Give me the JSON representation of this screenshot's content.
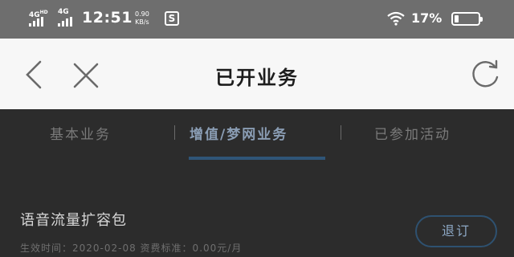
{
  "status_bar": {
    "network_1": "4G",
    "network_1_sup": "HD",
    "network_2": "4G",
    "time": "12:51",
    "speed_value": "0.90",
    "speed_unit": "KB/s",
    "app_icon_letter": "S",
    "battery_percent": "17%",
    "battery_level": 0.17
  },
  "nav": {
    "back_icon": "chevron-left-icon",
    "close_icon": "close-icon",
    "title": "已开业务",
    "refresh_icon": "refresh-icon"
  },
  "tabs": [
    {
      "label": "基本业务",
      "active": false
    },
    {
      "label": "增值/梦网业务",
      "active": true
    },
    {
      "label": "已参加活动",
      "active": false
    }
  ],
  "separator": "|",
  "service": {
    "name": "语音流量扩容包",
    "meta": "生效时间：2020-02-08  资费标准：0.00元/月",
    "action_label": "退订"
  },
  "colors": {
    "status_bar_bg": "#6e6e6e",
    "nav_bg": "#f7f7f7",
    "overlay_bg": "#2c2c2c",
    "accent": "#2f5577"
  }
}
